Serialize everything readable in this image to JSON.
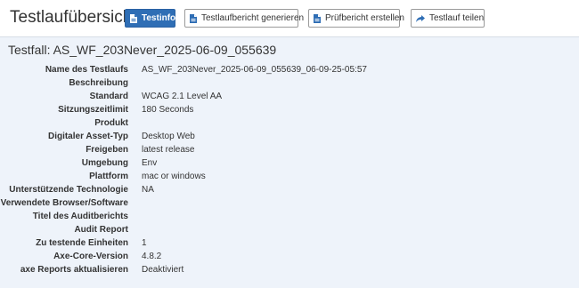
{
  "header": {
    "title": "Testlaufübersicht",
    "buttons": {
      "testinfo": "Testinfo",
      "generate_report": "Testlaufbericht generieren",
      "create_audit": "Prüfbericht erstellen",
      "share": "Testlauf teilen"
    },
    "colors": {
      "primary": "#2f6eb5",
      "panel_bg": "#eef3fa"
    }
  },
  "testcase": {
    "title": "Testfall: AS_WF_203Never_2025-06-09_055639",
    "fields": [
      {
        "label": "Name des Testlaufs",
        "value": "AS_WF_203Never_2025-06-09_055639_06-09-25-05:57"
      },
      {
        "label": "Beschreibung",
        "value": ""
      },
      {
        "label": "Standard",
        "value": "WCAG 2.1 Level AA"
      },
      {
        "label": "Sitzungszeitlimit",
        "value": "180 Seconds"
      },
      {
        "label": "Produkt",
        "value": ""
      },
      {
        "label": "Digitaler Asset-Typ",
        "value": "Desktop Web"
      },
      {
        "label": "Freigeben",
        "value": "latest release"
      },
      {
        "label": "Umgebung",
        "value": "Env"
      },
      {
        "label": "Plattform",
        "value": "mac or windows"
      },
      {
        "label": "Unterstützende Technologie",
        "value": "NA"
      },
      {
        "label": "Verwendete Browser/Software",
        "value": ""
      },
      {
        "label": "Titel des Auditberichts",
        "value": ""
      },
      {
        "label": "Audit Report",
        "value": ""
      },
      {
        "label": "Zu testende Einheiten",
        "value": "1"
      },
      {
        "label": "Axe-Core-Version",
        "value": "4.8.2"
      },
      {
        "label": "axe Reports aktualisieren",
        "value": "Deaktiviert"
      }
    ]
  }
}
